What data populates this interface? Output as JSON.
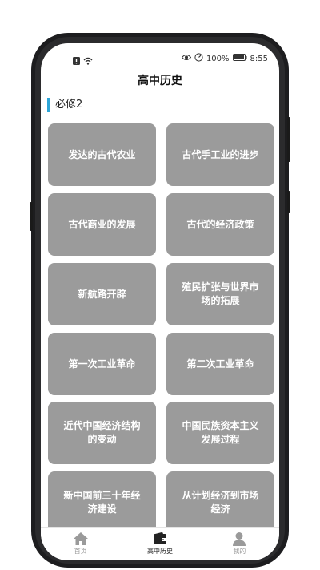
{
  "status_bar": {
    "battery_percent": "100%",
    "time": "8:55"
  },
  "header": {
    "title": "高中历史"
  },
  "section": {
    "title": "必修2"
  },
  "lessons": [
    {
      "label": "发达的古代农业"
    },
    {
      "label": "古代手工业的进步"
    },
    {
      "label": "古代商业的发展"
    },
    {
      "label": "古代的经济政策"
    },
    {
      "label": "新航路开辟"
    },
    {
      "label": "殖民扩张与世界市场的拓展"
    },
    {
      "label": "第一次工业革命"
    },
    {
      "label": "第二次工业革命"
    },
    {
      "label": "近代中国经济结构的变动"
    },
    {
      "label": "中国民族资本主义发展过程"
    },
    {
      "label": "新中国前三十年经济建设"
    },
    {
      "label": "从计划经济到市场经济"
    }
  ],
  "bottom_nav": {
    "items": [
      {
        "label": "首页",
        "icon": "home-icon"
      },
      {
        "label": "高中历史",
        "icon": "wallet-icon",
        "active": true
      },
      {
        "label": "我的",
        "icon": "user-icon"
      }
    ]
  },
  "colors": {
    "accent": "#2ea6d8",
    "tile": "#9b9b9b",
    "nav_inactive": "#999999"
  }
}
